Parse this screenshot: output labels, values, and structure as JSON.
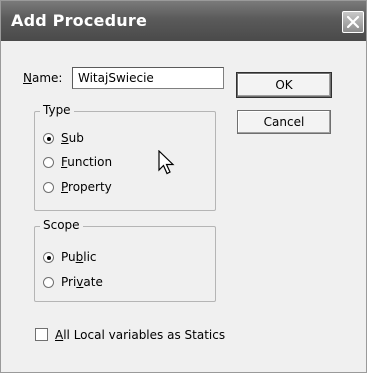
{
  "window": {
    "title": "Add Procedure"
  },
  "name_field": {
    "label_mnemonic": "N",
    "label_rest": "ame:",
    "value": "WitajSwiecie"
  },
  "buttons": {
    "ok": "OK",
    "cancel": "Cancel"
  },
  "type_group": {
    "title": "Type",
    "options": [
      {
        "pre": "",
        "mnemonic": "S",
        "post": "ub",
        "checked": true
      },
      {
        "pre": "",
        "mnemonic": "F",
        "post": "unction",
        "checked": false
      },
      {
        "pre": "",
        "mnemonic": "P",
        "post": "roperty",
        "checked": false
      }
    ]
  },
  "scope_group": {
    "title": "Scope",
    "options": [
      {
        "pre": "Pu",
        "mnemonic": "b",
        "post": "lic",
        "checked": true
      },
      {
        "pre": "Pri",
        "mnemonic": "v",
        "post": "ate",
        "checked": false
      }
    ]
  },
  "statics_checkbox": {
    "mnemonic": "A",
    "rest": "ll Local variables as Statics",
    "checked": false
  }
}
